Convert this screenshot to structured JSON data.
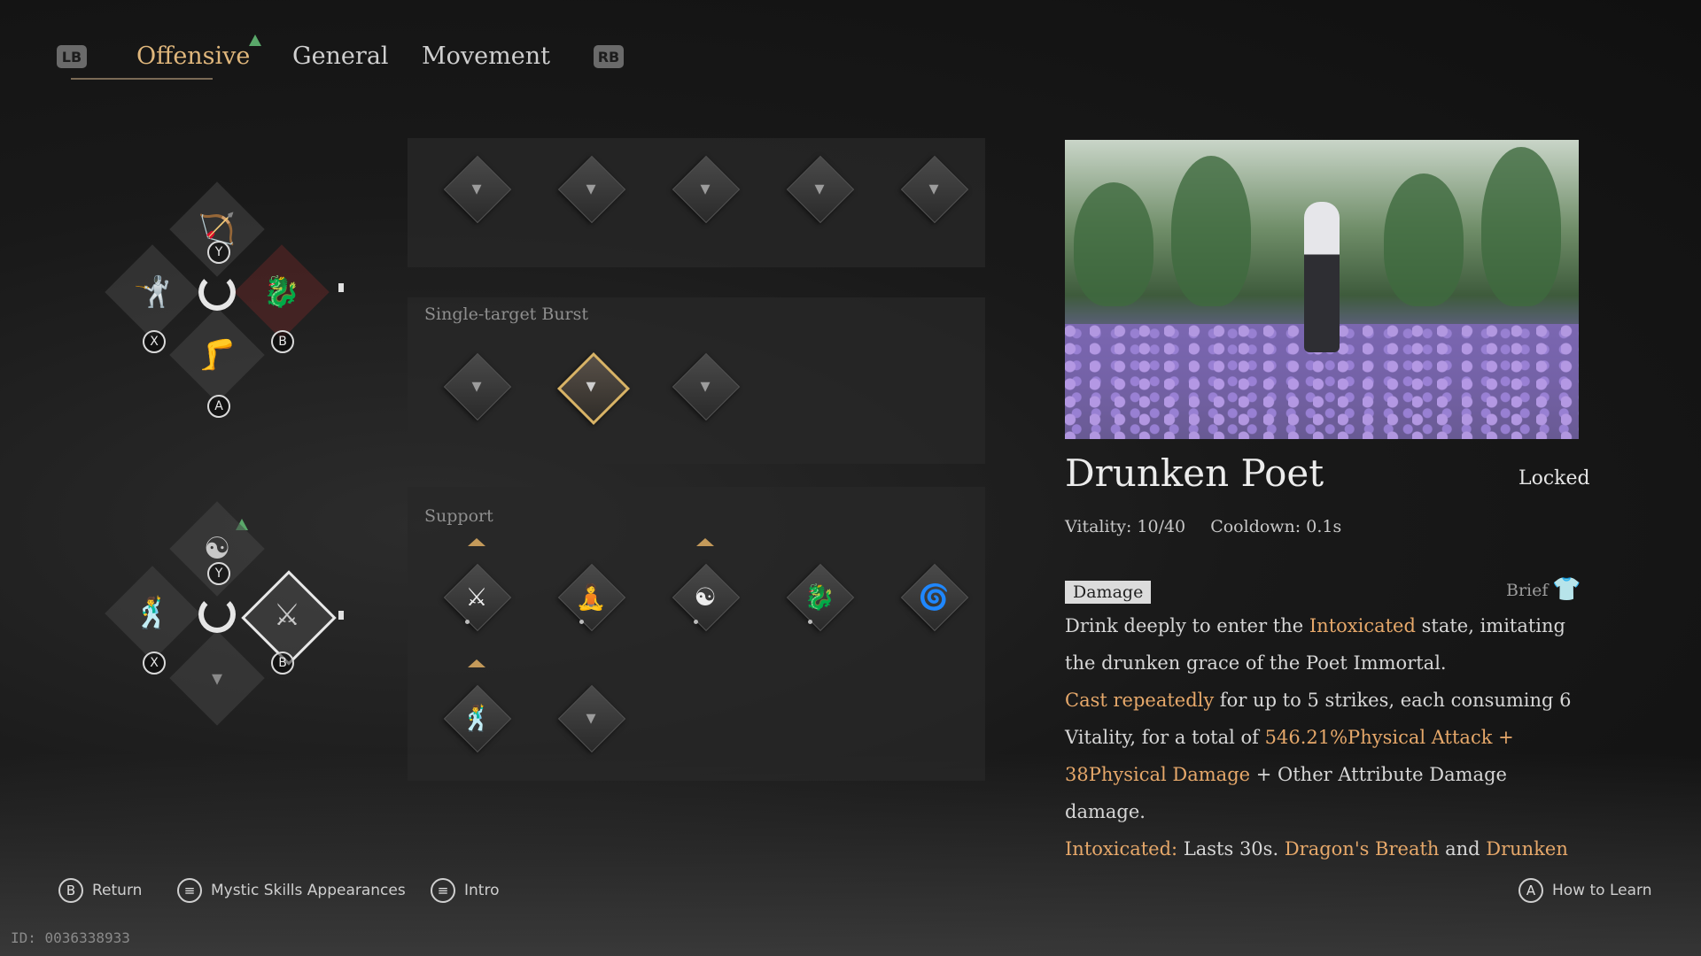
{
  "tabs": {
    "lb": "LB",
    "rb": "RB",
    "items": [
      {
        "label": "Offensive",
        "active": true
      },
      {
        "label": "General",
        "active": false
      },
      {
        "label": "Movement",
        "active": false
      }
    ]
  },
  "wheels": {
    "top": {
      "y": "Y",
      "x": "X",
      "b": "B",
      "a": "A"
    },
    "bottom": {
      "y": "Y",
      "x": "X",
      "b": "B"
    }
  },
  "panels": {
    "section1": {
      "slots": 5,
      "icon": "locked-slot-icon"
    },
    "burst": {
      "label": "Single-target Burst",
      "slots": 3,
      "selected_index": 1
    },
    "support": {
      "label": "Support",
      "icons": [
        "crossed-swords-icon",
        "meditating-figure-icon",
        "yin-yang-icon",
        "dragon-icon",
        "swirl-icon",
        "dancing-figure-icon",
        "locked-slot-icon"
      ]
    }
  },
  "detail": {
    "title": "Drunken Poet",
    "status": "Locked",
    "vitality": "Vitality: 10/40",
    "cooldown": "Cooldown: 0.1s",
    "tag": "Damage",
    "brief": "Brief",
    "desc": {
      "p1a": "Drink deeply to enter the ",
      "p1b": "Intoxicated",
      "p1c": " state, imitating the drunken grace of the Poet Immortal.",
      "p2a": "Cast repeatedly",
      "p2b": " for up to 5 strikes, each consuming 6 Vitality, for a total of ",
      "p2c": "546.21%Physical Attack + 38Physical Damage",
      "p2d": " + Other Attribute Damage damage.",
      "p3a": "Intoxicated:",
      "p3b": " Lasts 30s. ",
      "p3c": "Dragon's Breath",
      "p3d": " and ",
      "p3e": "Drunken"
    }
  },
  "footer": {
    "return_btn": "B",
    "return_label": "Return",
    "appearances_label": "Mystic Skills Appearances",
    "intro_label": "Intro",
    "learn_btn": "A",
    "learn_label": "How to Learn",
    "id_text": "ID: 0036338933"
  },
  "colors": {
    "accent": "#e0b77c",
    "highlight": "#e6a86a",
    "selected_border": "#d8b366"
  }
}
